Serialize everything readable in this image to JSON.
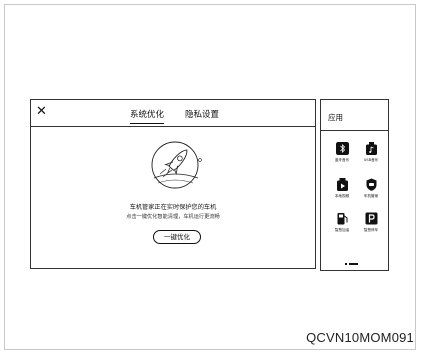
{
  "dialog": {
    "close_symbol": "✕",
    "tabs": [
      {
        "label": "系统优化",
        "active": true
      },
      {
        "label": "隐私设置",
        "active": false
      }
    ],
    "status_text": "车机管家正在实时保护您的车机",
    "sub_text": "点击一键优化智能清理，车机运行更流畅",
    "optimize_button": "一键优化",
    "illustration_icon": "rocket-icon"
  },
  "apps_panel": {
    "title": "应用",
    "items": [
      {
        "label": "蓝牙音乐",
        "icon": "bluetooth-music-icon"
      },
      {
        "label": "USB音乐",
        "icon": "usb-music-icon"
      },
      {
        "label": "本地视频",
        "icon": "local-video-icon"
      },
      {
        "label": "车机管家",
        "icon": "vehicle-manager-icon"
      },
      {
        "label": "智慧加油",
        "icon": "fuel-icon"
      },
      {
        "label": "智慧停车",
        "icon": "parking-icon"
      }
    ]
  },
  "watermark": "QCVN10MOM091"
}
